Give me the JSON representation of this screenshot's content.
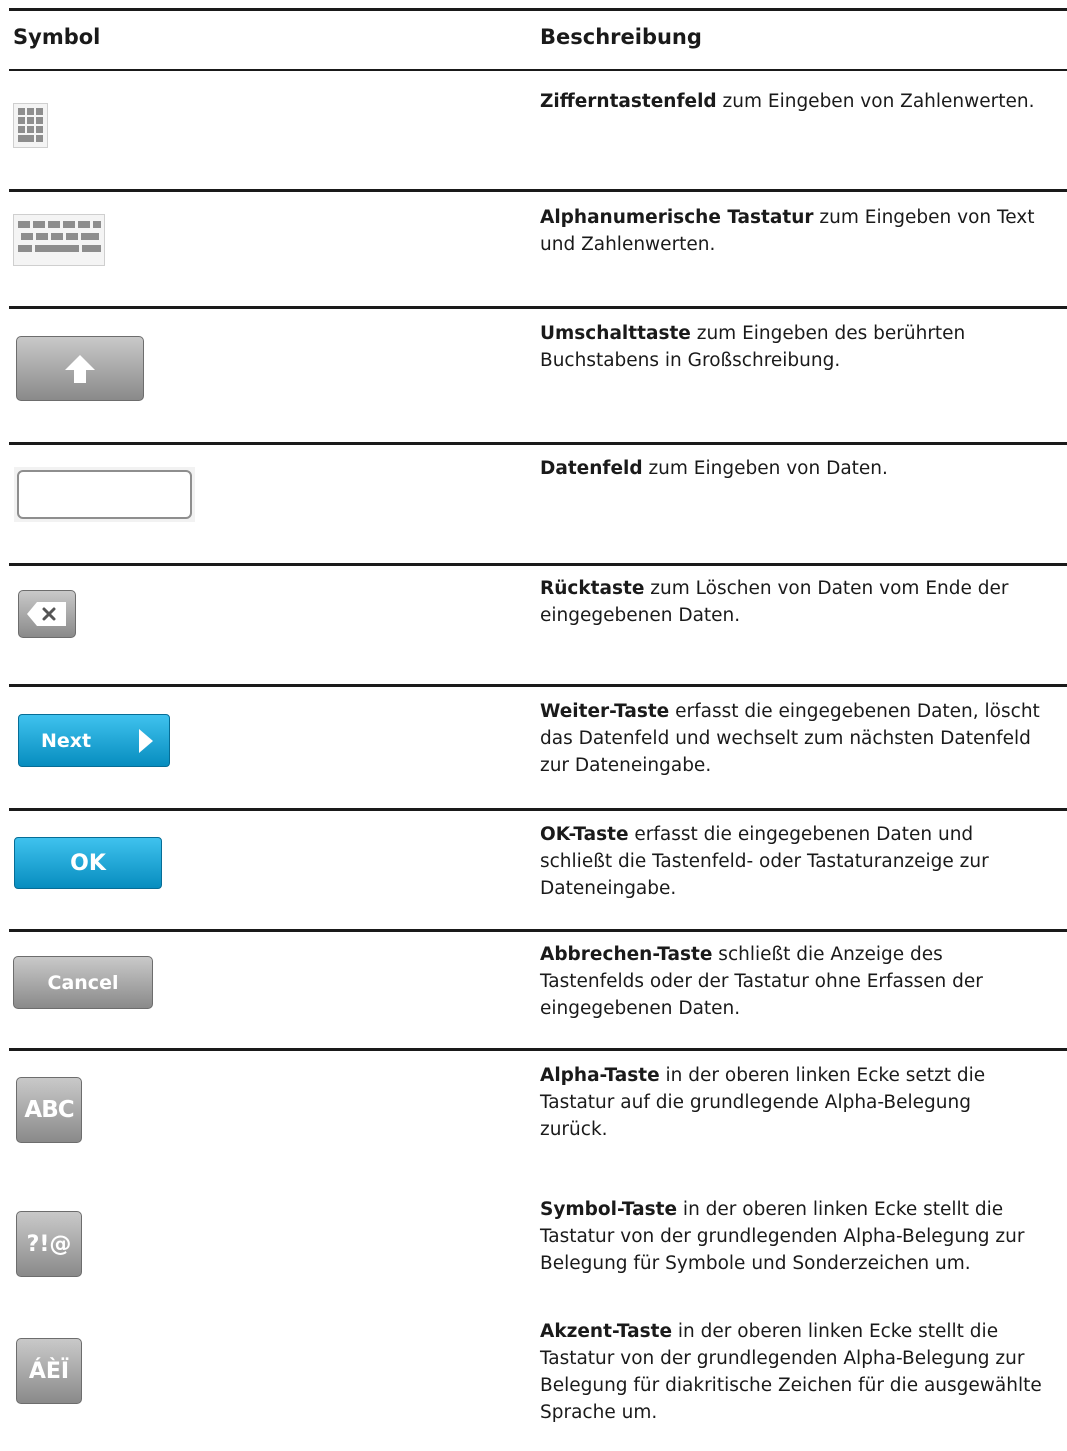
{
  "header": {
    "symbol": "Symbol",
    "description": "Beschreibung"
  },
  "rows": [
    {
      "icon": "keypad-icon",
      "term": "Zifferntastenfeld",
      "text_1": " zum Eingeben von Zahlenwerten."
    },
    {
      "icon": "keyboard-icon",
      "term": "Alphanumerische Tastatur",
      "text_1": " zum Eingeben von Text",
      "text_2": "und Zahlenwerten."
    },
    {
      "icon": "shift-arrow-icon",
      "term": "Umschalttaste",
      "text_1": " zum Eingeben des berührten",
      "text_2": "Buchstabens in Großschreibung."
    },
    {
      "icon": "data-field-icon",
      "term": "Datenfeld",
      "text_1": " zum Eingeben von Daten."
    },
    {
      "icon": "backspace-icon",
      "term": "Rücktaste",
      "text_1": " zum Löschen von Daten vom Ende der",
      "text_2": "eingegebenen Daten."
    },
    {
      "icon_label": "Next",
      "term": "Weiter-Taste",
      "text_1": " erfasst die eingegebenen Daten, löscht",
      "text_2": "das Datenfeld und wechselt zum nächsten Datenfeld",
      "text_3": "zur Dateneingabe."
    },
    {
      "icon_label": "OK",
      "term": "OK-Taste",
      "text_1": " erfasst die eingegebenen Daten und",
      "text_2": "schließt die Tastenfeld- oder Tastaturanzeige zur",
      "text_3": "Dateneingabe."
    },
    {
      "icon_label": "Cancel",
      "term": "Abbrechen-Taste",
      "text_1": " schließt die Anzeige des",
      "text_2": "Tastenfelds oder der Tastatur ohne Erfassen der",
      "text_3": "eingegebenen Daten."
    },
    {
      "icon_label": "ABC",
      "term": "Alpha-Taste",
      "text_1": " in der oberen linken Ecke setzt die",
      "text_2": "Tastatur auf die grundlegende Alpha-Belegung",
      "text_3": "zurück."
    },
    {
      "icon_label": "?!@",
      "term": "Symbol-Taste",
      "text_1": " in der oberen linken Ecke stellt die",
      "text_2": "Tastatur von der grundlegenden Alpha-Belegung zur",
      "text_3": "Belegung für Symbole und Sonderzeichen um."
    },
    {
      "icon_label": "ÁÈÏ",
      "term": "Akzent-Taste",
      "text_1": " in der oberen linken Ecke stellt die",
      "text_2": "Tastatur von der grundlegenden Alpha-Belegung zur",
      "text_3": "Belegung für diakritische Zeichen für die ausgewählte",
      "text_4": "Sprache um."
    }
  ]
}
